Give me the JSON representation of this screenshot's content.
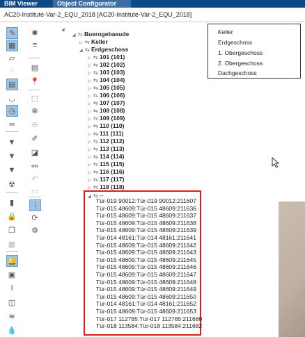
{
  "tabs": [
    "BIM Viewer",
    "Object Configurator"
  ],
  "model_title": "AC20-Institute-Var-2_EQU_2018 [AC20-Institute-Var-2_EQU_2018]",
  "tree": {
    "root": "Buerogebaeude",
    "levels": [
      "Keller",
      "Erdgeschoss"
    ],
    "rooms": [
      "101 (101)",
      "102 (102)",
      "103 (103)",
      "104 (104)",
      "105 (105)",
      "106 (106)",
      "107 (107)",
      "108 (108)",
      "109 (109)",
      "110 (110)",
      "111 (111)",
      "112 (112)",
      "113 (113)",
      "114 (114)",
      "115 (115)",
      "116 (116)",
      "117 (117)",
      "118 (118)"
    ],
    "selected_group": "--",
    "doors": [
      "Tür-019 90012:Tür-019 90012:211607",
      "Tür-015 48609:Tür-015 48609:211636",
      "Tür-015 48609:Tür-015 48609:211637",
      "Tür-015 48609:Tür-015 48609:211638",
      "Tür-015 48609:Tür-015 48609:211639",
      "Tür-014 48161:Tür-014 48161:211641",
      "Tür-015 48609:Tür-015 48609:211642",
      "Tür-015 48609:Tür-015 48609:211643",
      "Tür-015 48609:Tür-015 48609:211645",
      "Tür-015 48609:Tür-015 48609:211646",
      "Tür-015 48609:Tür-015 48609:211647",
      "Tür-015 48609:Tür-015 48609:211648",
      "Tür-015 48609:Tür-015 48609:211649",
      "Tür-015 48609:Tür-015 48609:211650",
      "Tür-014 48161:Tür-014 48161:211652",
      "Tür-015 48609:Tür-015 48609:211653",
      "Tür-017 112765:Tür-017 112765:211680",
      "Tür-018 113584:Tür-018 113584:211682"
    ]
  },
  "legend": [
    "Keller",
    "Erdgeschoss",
    "1. Obergeschoss",
    "2. Obergeschoss",
    "Dachgeschoss"
  ],
  "colors": {
    "tab_active": "#0b4a86",
    "tab_inactive": "#3a6ea5",
    "selection_border": "#d81e1e",
    "tool_active": "#9fc3e5"
  }
}
